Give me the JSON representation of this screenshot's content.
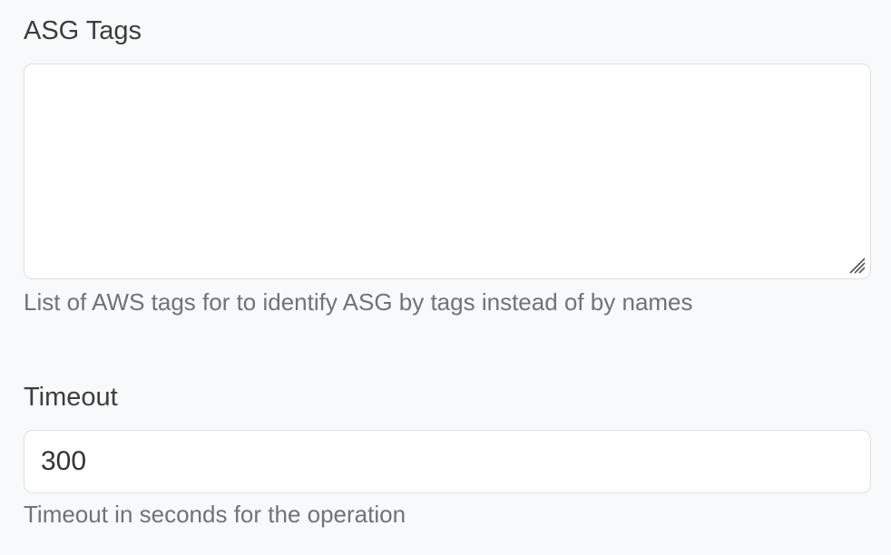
{
  "asg_tags": {
    "label": "ASG Tags",
    "value": "",
    "help": "List of AWS tags for to identify ASG by tags instead of by names"
  },
  "timeout": {
    "label": "Timeout",
    "value": "300",
    "help": "Timeout in seconds for the operation"
  },
  "icons": {
    "resize": "resize-grip-icon"
  },
  "colors": {
    "background": "#f8f9fb",
    "field_border": "#dcdfe3",
    "label_text": "#3d3d3d",
    "help_text": "#6f7378"
  }
}
